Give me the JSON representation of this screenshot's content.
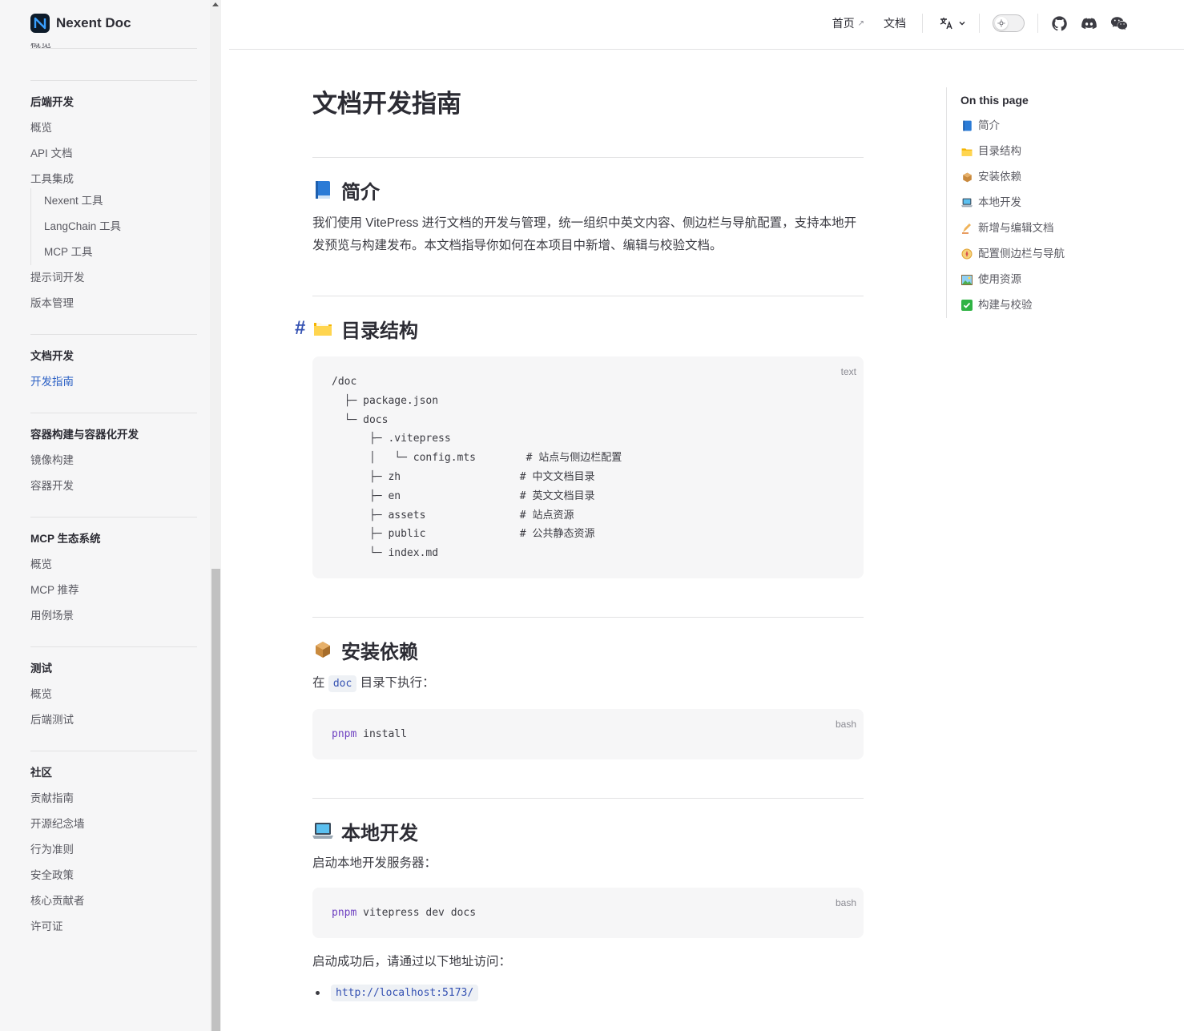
{
  "brand": {
    "name": "Nexent Doc"
  },
  "sidebar": {
    "cut_item": "概览",
    "groups": [
      {
        "title": "后端开发",
        "items": [
          "概览",
          "API 文档",
          "工具集成"
        ],
        "sub_items": [
          "Nexent 工具",
          "LangChain 工具",
          "MCP 工具"
        ],
        "after_items": [
          "提示词开发",
          "版本管理"
        ]
      },
      {
        "title": "文档开发",
        "items": [
          "开发指南"
        ]
      },
      {
        "title": "容器构建与容器化开发",
        "items": [
          "镜像构建",
          "容器开发"
        ]
      },
      {
        "title": "MCP 生态系统",
        "items": [
          "概览",
          "MCP 推荐",
          "用例场景"
        ]
      },
      {
        "title": "测试",
        "items": [
          "概览",
          "后端测试"
        ]
      },
      {
        "title": "社区",
        "items": [
          "贡献指南",
          "开源纪念墙",
          "行为准则",
          "安全政策",
          "核心贡献者",
          "许可证"
        ]
      }
    ]
  },
  "topnav": {
    "home": "首页",
    "home_ext": "↗",
    "docs": "文档",
    "lang_icon": "translate-icon"
  },
  "page": {
    "title": "文档开发指南",
    "intro": {
      "heading": "简介",
      "text": "我们使用 VitePress 进行文档的开发与管理，统一组织中英文内容、侧边栏与导航配置，支持本地开发预览与构建发布。本文档指导你如何在本项目中新增、编辑与校验文档。"
    },
    "structure": {
      "heading": "目录结构",
      "anchor": "#",
      "lang": "text",
      "code": "/doc\n  ├─ package.json\n  └─ docs\n      ├─ .vitepress\n      │   └─ config.mts        # 站点与侧边栏配置\n      ├─ zh                   # 中文文档目录\n      ├─ en                   # 英文文档目录\n      ├─ assets               # 站点资源\n      ├─ public               # 公共静态资源\n      └─ index.md"
    },
    "install": {
      "heading": "安装依赖",
      "text_before": "在",
      "code_inline": "doc",
      "text_after": "目录下执行：",
      "lang": "bash",
      "cmd_kw": "pnpm",
      "cmd_rest": " install"
    },
    "local": {
      "heading": "本地开发",
      "text": "启动本地开发服务器：",
      "lang": "bash",
      "cmd_kw": "pnpm",
      "cmd_rest": " vitepress dev docs",
      "after_text": "启动成功后，请通过以下地址访问：",
      "url": "http://localhost:5173/"
    }
  },
  "toc": {
    "title": "On this page",
    "items": [
      "简介",
      "目录结构",
      "安装依赖",
      "本地开发",
      "新增与编辑文档",
      "配置侧边栏与导航",
      "使用资源",
      "构建与校验"
    ]
  },
  "colors": {
    "accent": "#3451b2",
    "active_link": "#2e62c5"
  }
}
